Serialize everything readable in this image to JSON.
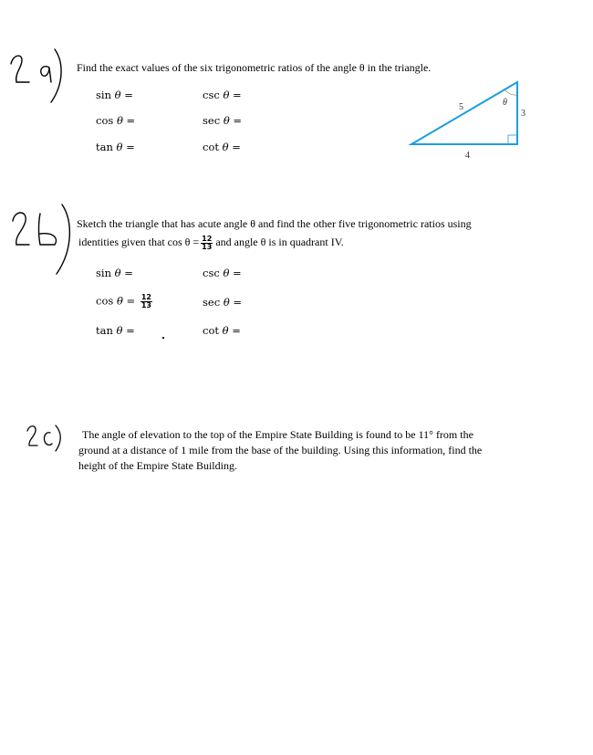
{
  "problems": [
    {
      "handwritten_label": "2a)",
      "prompt": "Find the exact values of the six trigonometric ratios of the angle θ in the triangle.",
      "ratios": [
        {
          "name": "sin",
          "symbol": "θ",
          "value": ""
        },
        {
          "name": "csc",
          "symbol": "θ",
          "value": ""
        },
        {
          "name": "cos",
          "symbol": "θ",
          "value": ""
        },
        {
          "name": "sec",
          "symbol": "θ",
          "value": ""
        },
        {
          "name": "tan",
          "symbol": "θ",
          "value": ""
        },
        {
          "name": "cot",
          "symbol": "θ",
          "value": ""
        }
      ],
      "triangle": {
        "hypotenuse": "5",
        "vertical_leg": "3",
        "horizontal_leg": "4",
        "angle_label": "θ",
        "stroke_color": "#1a9fe0"
      }
    },
    {
      "handwritten_label": "2b)",
      "prompt_line1": "Sketch the triangle that has acute angle θ and find the other five trigonometric ratios using",
      "prompt_line2_pre": "identities given that cos θ =",
      "prompt_fraction": {
        "numerator": "12",
        "denominator": "13"
      },
      "prompt_line2_post": "and angle θ is in quadrant IV.",
      "ratios": [
        {
          "name": "sin",
          "symbol": "θ",
          "value": ""
        },
        {
          "name": "csc",
          "symbol": "θ",
          "value": ""
        },
        {
          "name": "cos",
          "symbol": "θ",
          "value": {
            "numerator": "12",
            "denominator": "13"
          }
        },
        {
          "name": "sec",
          "symbol": "θ",
          "value": ""
        },
        {
          "name": "tan",
          "symbol": "θ",
          "value": ""
        },
        {
          "name": "cot",
          "symbol": "θ",
          "value": ""
        }
      ]
    },
    {
      "handwritten_label": "2c)",
      "prompt_line1": "The angle of elevation to the top of the Empire State Building is found to be 11° from the",
      "prompt_line2": "ground at a distance of 1 mile from the base of the building. Using this information, find the",
      "prompt_line3": "height of the Empire State Building."
    }
  ],
  "eq_sign": "="
}
